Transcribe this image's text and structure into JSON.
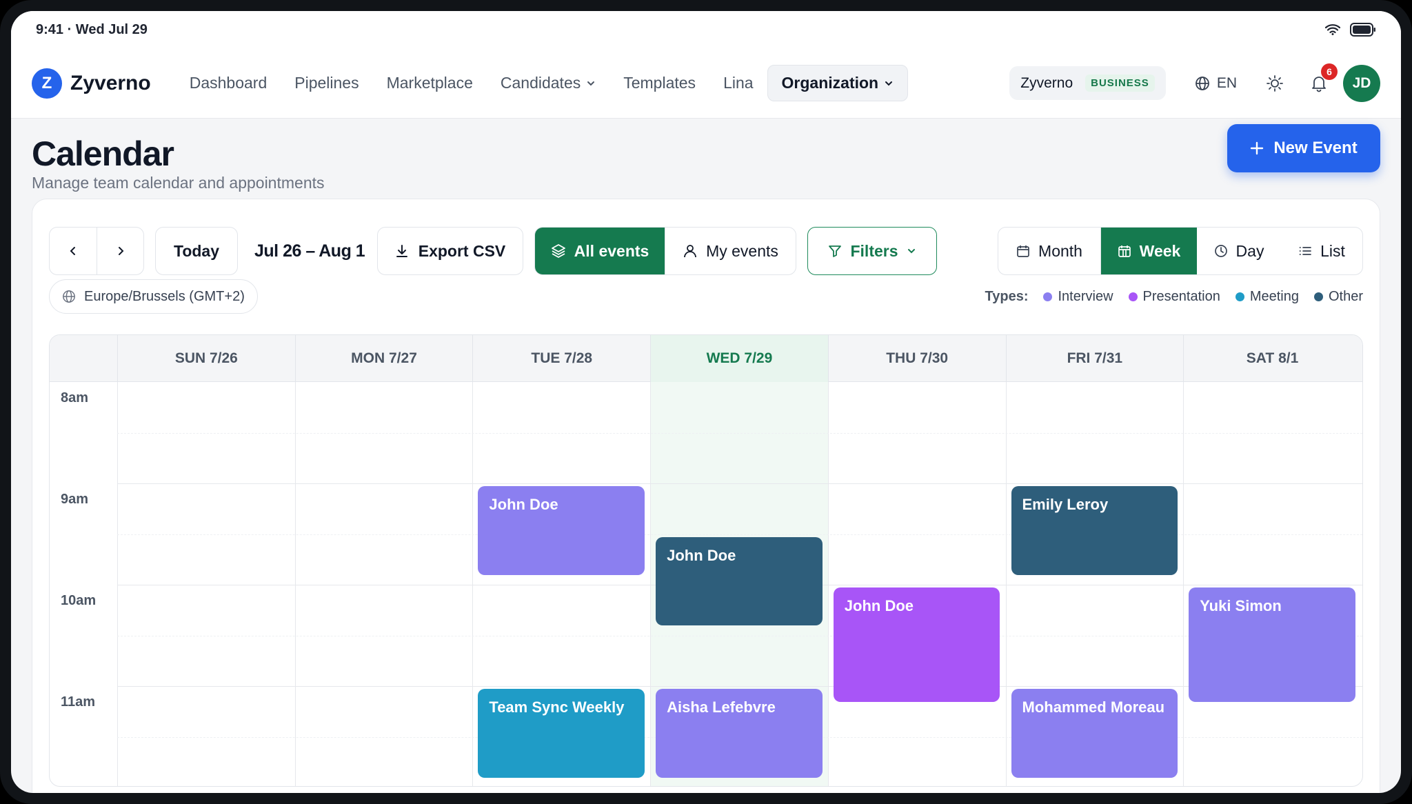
{
  "statusbar": {
    "time": "9:41 · Wed Jul 29"
  },
  "nav": {
    "brand": "Zyverno",
    "logo_letter": "Z",
    "links": [
      "Dashboard",
      "Pipelines",
      "Marketplace",
      "Candidates",
      "Templates",
      "Lina",
      "Organization"
    ],
    "plan_name": "Zyverno",
    "plan_badge": "BUSINESS",
    "lang": "EN",
    "notifications": "6",
    "avatar": "JD"
  },
  "page": {
    "title": "Calendar",
    "subtitle": "Manage team calendar and appointments",
    "new_event": "New Event"
  },
  "toolbar": {
    "today": "Today",
    "range": "Jul 26 – Aug 1",
    "export": "Export CSV",
    "all_events": "All events",
    "my_events": "My events",
    "filters": "Filters",
    "views": [
      "Month",
      "Week",
      "Day",
      "List"
    ]
  },
  "timezone": "Europe/Brussels (GMT+2)",
  "types": {
    "label": "Types:",
    "items": [
      {
        "name": "Interview",
        "color": "#8b7ff0"
      },
      {
        "name": "Presentation",
        "color": "#a855f7"
      },
      {
        "name": "Meeting",
        "color": "#1f9cc7"
      },
      {
        "name": "Other",
        "color": "#2e5e7b"
      }
    ]
  },
  "days": [
    "SUN 7/26",
    "MON 7/27",
    "TUE 7/28",
    "WED 7/29",
    "THU 7/30",
    "FRI 7/31",
    "SAT 8/1"
  ],
  "hours": [
    "8am",
    "9am",
    "10am",
    "11am"
  ],
  "events": [
    {
      "title": "John Doe",
      "day": 2,
      "start": "9:00",
      "end": "9:55",
      "type": "Interview",
      "color": "#8b7ff0"
    },
    {
      "title": "John Doe",
      "day": 3,
      "start": "9:30",
      "end": "10:25",
      "type": "Other",
      "color": "#2e5e7b"
    },
    {
      "title": "Emily Leroy",
      "day": 5,
      "start": "9:00",
      "end": "9:55",
      "type": "Other",
      "color": "#2e5e7b"
    },
    {
      "title": "John Doe",
      "day": 4,
      "start": "10:00",
      "end": "11:10",
      "type": "Presentation",
      "color": "#a855f7"
    },
    {
      "title": "Yuki Simon",
      "day": 6,
      "start": "10:00",
      "end": "11:10",
      "type": "Interview",
      "color": "#8b7ff0"
    },
    {
      "title": "Team Sync Weekly",
      "day": 2,
      "start": "11:00",
      "end": "11:55",
      "type": "Meeting",
      "color": "#1f9cc7"
    },
    {
      "title": "Aisha Lefebvre",
      "day": 3,
      "start": "11:00",
      "end": "11:55",
      "type": "Interview",
      "color": "#8b7ff0"
    },
    {
      "title": "Mohammed Moreau",
      "day": 5,
      "start": "11:00",
      "end": "11:55",
      "type": "Interview",
      "color": "#8b7ff0"
    }
  ]
}
